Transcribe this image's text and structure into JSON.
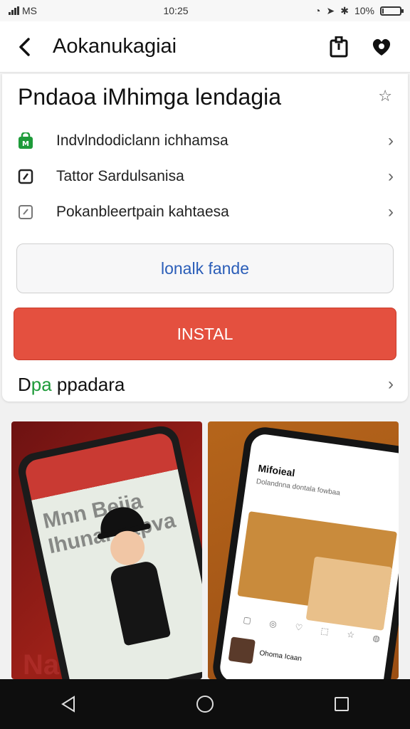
{
  "status_bar": {
    "carrier": "MS",
    "time": "10:25",
    "battery_text": "10%",
    "battery_level": 0.1
  },
  "header": {
    "title": "Aokanukagiai"
  },
  "app": {
    "title": "Pndaoa iMhimga lendagia",
    "rows": [
      {
        "label": "Indvlndodiclann ichhamsa",
        "icon": "shopping-bag-icon",
        "icon_color": "#1e9b3a"
      },
      {
        "label": "Tattor Sardulsanisa",
        "icon": "check-square-icon"
      },
      {
        "label": "Pokanbleertpain kahtaesa",
        "icon": "edit-square-icon"
      }
    ],
    "secondary_button": "lonalk fande",
    "install_button": "INSTAL",
    "details": {
      "label_green": "pa",
      "label_prefix": "D",
      "label_suffix": " ppadara"
    }
  },
  "screenshots": {
    "shot1": {
      "bg_text": "Naic",
      "screen_text": "Mnn Beija Ihunar Stpva"
    },
    "shot2": {
      "screen_title": "Mifoieal",
      "screen_subtitle": "Dolandnna dontala fowbaa",
      "row_text": "Ohoma Icaan"
    }
  },
  "colors": {
    "install": "#e4503f",
    "link": "#2a5db8",
    "green": "#1e9b3a"
  },
  "navbar": {
    "buttons": [
      "back-icon",
      "home-icon",
      "recents-icon"
    ]
  }
}
